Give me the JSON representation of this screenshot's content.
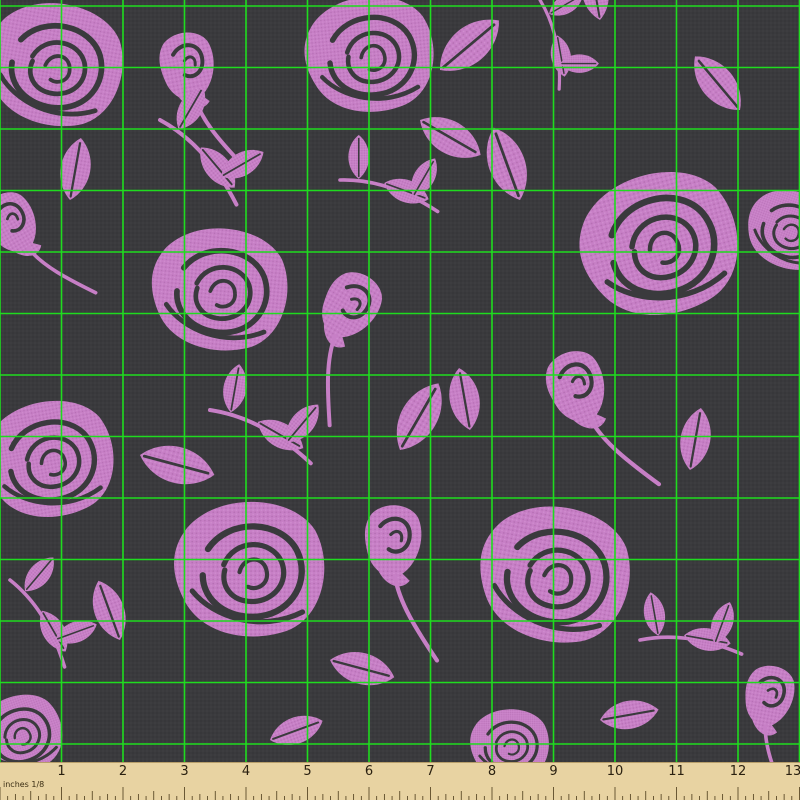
{
  "colors": {
    "background": "#3a3a3d",
    "rose": "#c77fc6",
    "grid": "#1fdc1f",
    "ruler": "#e8d3a2"
  },
  "ruler": {
    "unit_label": "inches 1/8",
    "numbers": [
      "1",
      "2",
      "3",
      "4",
      "5",
      "6",
      "7",
      "8",
      "9",
      "10",
      "11",
      "12",
      "13"
    ]
  }
}
